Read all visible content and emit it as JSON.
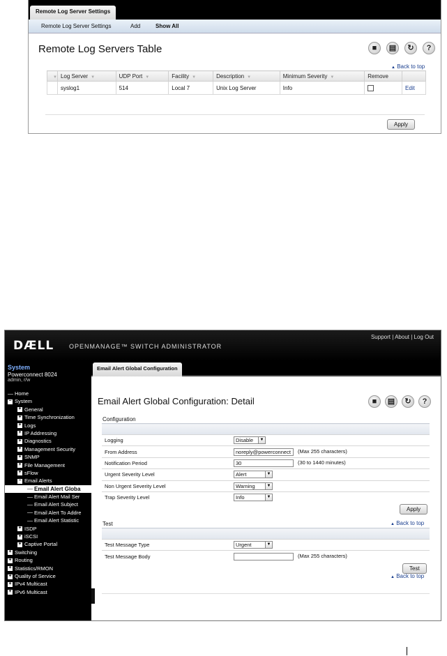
{
  "screen1": {
    "tab_label": "Remote Log Server Settings",
    "subnav": [
      "Remote Log Server Settings",
      "Add",
      "Show All"
    ],
    "title": "Remote Log Servers Table",
    "toolbar_icons": [
      "save-icon",
      "print-icon",
      "refresh-icon",
      "help-icon"
    ],
    "back_to_top": "Back to top",
    "table": {
      "columns": [
        "Log Server",
        "UDP Port",
        "Facility",
        "Description",
        "Minimum Severity",
        "Remove",
        ""
      ],
      "rows": [
        {
          "log_server": "syslog1",
          "udp_port": "514",
          "facility": "Local 7",
          "description": "Unix Log Server",
          "min_severity": "Info",
          "remove": false,
          "edit": "Edit"
        }
      ]
    },
    "apply_label": "Apply"
  },
  "screen2": {
    "header": {
      "logo": "DÆLL",
      "product": "OPENMANAGE™ SWITCH ADMINISTRATOR",
      "links": [
        "Support",
        "About",
        "Log Out"
      ]
    },
    "system": {
      "label": "System",
      "model": "Powerconnect 8024",
      "user": "admin, r/w"
    },
    "tab_label": "Email Alert Global Configuration",
    "nav": [
      {
        "label": "Home",
        "indent": 0,
        "exp": ""
      },
      {
        "label": "System",
        "indent": 0,
        "exp": "−"
      },
      {
        "label": "General",
        "indent": 1,
        "exp": "+"
      },
      {
        "label": "Time Synchronization",
        "indent": 1,
        "exp": "+"
      },
      {
        "label": "Logs",
        "indent": 1,
        "exp": "+"
      },
      {
        "label": "IP Addressing",
        "indent": 1,
        "exp": "+"
      },
      {
        "label": "Diagnostics",
        "indent": 1,
        "exp": "+"
      },
      {
        "label": "Management Security",
        "indent": 1,
        "exp": "+"
      },
      {
        "label": "SNMP",
        "indent": 1,
        "exp": "+"
      },
      {
        "label": "File Management",
        "indent": 1,
        "exp": "+"
      },
      {
        "label": "sFlow",
        "indent": 1,
        "exp": "+"
      },
      {
        "label": "Email Alerts",
        "indent": 1,
        "exp": "−"
      },
      {
        "label": "Email Alert Globa",
        "indent": 2,
        "exp": "",
        "selected": true
      },
      {
        "label": "Email Alert Mail Ser",
        "indent": 2,
        "exp": ""
      },
      {
        "label": "Email Alert Subject",
        "indent": 2,
        "exp": ""
      },
      {
        "label": "Email Alert To Addre",
        "indent": 2,
        "exp": ""
      },
      {
        "label": "Email Alert Statistic",
        "indent": 2,
        "exp": ""
      },
      {
        "label": "ISDP",
        "indent": 1,
        "exp": "+"
      },
      {
        "label": "iSCSI",
        "indent": 1,
        "exp": "+"
      },
      {
        "label": "Captive Portal",
        "indent": 1,
        "exp": "+"
      },
      {
        "label": "Switching",
        "indent": 0,
        "exp": "+"
      },
      {
        "label": "Routing",
        "indent": 0,
        "exp": "+"
      },
      {
        "label": "Statistics/RMON",
        "indent": 0,
        "exp": "+"
      },
      {
        "label": "Quality of Service",
        "indent": 0,
        "exp": "+"
      },
      {
        "label": "IPv4 Multicast",
        "indent": 0,
        "exp": "+"
      },
      {
        "label": "IPv6 Multicast",
        "indent": 0,
        "exp": "+"
      }
    ],
    "title": "Email Alert Global Configuration: Detail",
    "toolbar_icons": [
      "save-icon",
      "print-icon",
      "refresh-icon",
      "help-icon"
    ],
    "configuration": {
      "label": "Configuration",
      "fields": [
        {
          "label": "Logging",
          "type": "select",
          "value": "Disable"
        },
        {
          "label": "From Address",
          "type": "text",
          "value": "noreply@powerconnect",
          "hint": "(Max 255 characters)"
        },
        {
          "label": "Notification Period",
          "type": "text",
          "value": "30",
          "hint": "(30 to 1440 minutes)"
        },
        {
          "label": "Urgent Severity Level",
          "type": "select",
          "value": "Alert"
        },
        {
          "label": "Non Urgent Severity Level",
          "type": "select",
          "value": "Warning"
        },
        {
          "label": "Trap Severity Level",
          "type": "select",
          "value": "Info"
        }
      ],
      "apply_label": "Apply"
    },
    "test": {
      "label": "Test",
      "back_to_top": "Back to top",
      "fields": [
        {
          "label": "Test Message Type",
          "type": "select",
          "value": "Urgent"
        },
        {
          "label": "Test Message Body",
          "type": "text",
          "value": "",
          "hint": "(Max 255 characters)"
        }
      ],
      "test_label": "Test",
      "back_to_top_2": "Back to top"
    }
  }
}
